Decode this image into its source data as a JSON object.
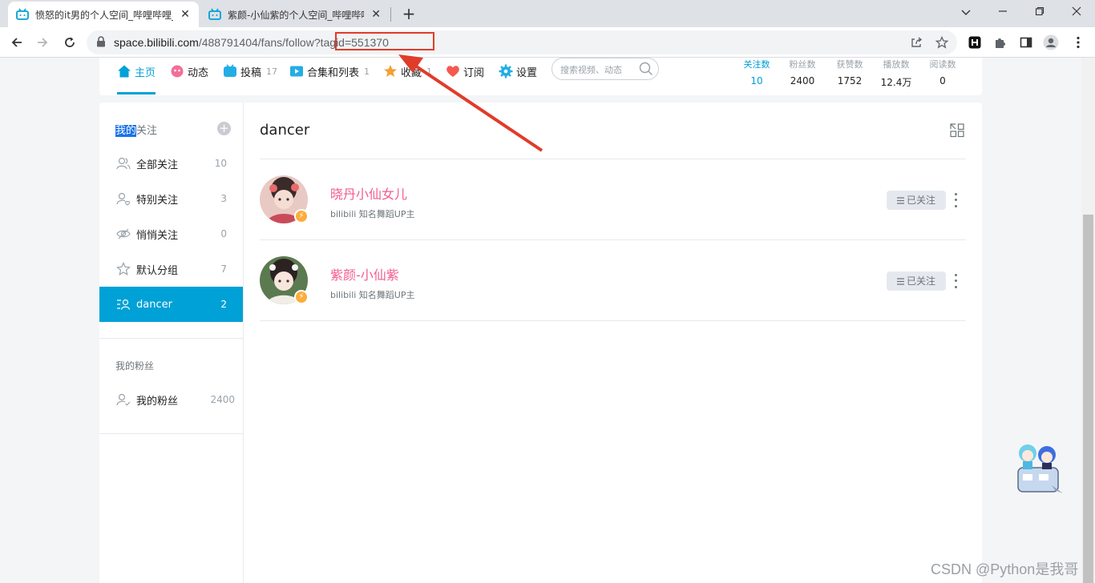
{
  "browser": {
    "tabs": [
      {
        "title": "愤怒的it男的个人空间_哔哩哔哩_",
        "active": true
      },
      {
        "title": "紫颜-小仙紫的个人空间_哔哩哔哩",
        "active": false
      }
    ],
    "url_host": "space.bilibili.com",
    "url_path": "/488791404/fans/follow?tagid=551370",
    "tab_close": "✕",
    "new_tab": "+"
  },
  "nav": {
    "items": [
      {
        "label": "主页",
        "count": "",
        "icon": "home-icon",
        "color": "#00a1d6"
      },
      {
        "label": "动态",
        "count": "",
        "icon": "dynamic-icon",
        "color": "#f36f98"
      },
      {
        "label": "投稿",
        "count": "17",
        "icon": "upload-icon",
        "color": "#23ade5"
      },
      {
        "label": "合集和列表",
        "count": "1",
        "icon": "collection-icon",
        "color": "#23ade5"
      },
      {
        "label": "收藏",
        "count": "1",
        "icon": "star-icon",
        "color": "#f3a034"
      },
      {
        "label": "订阅",
        "count": "",
        "icon": "heart-icon",
        "color": "#f45a4f"
      },
      {
        "label": "设置",
        "count": "",
        "icon": "gear-icon",
        "color": "#23ade5"
      }
    ],
    "search_placeholder": "搜索视频、动态",
    "stats": [
      {
        "label": "关注数",
        "value": "10"
      },
      {
        "label": "粉丝数",
        "value": "2400"
      },
      {
        "label": "获赞数",
        "value": "1752"
      },
      {
        "label": "播放数",
        "value": "12.4万"
      },
      {
        "label": "阅读数",
        "value": "0"
      }
    ]
  },
  "sidebar": {
    "head_selected": "我的",
    "head_rest": "关注",
    "add": "+",
    "items": [
      {
        "label": "全部关注",
        "count": "10"
      },
      {
        "label": "特别关注",
        "count": "3"
      },
      {
        "label": "悄悄关注",
        "count": "0"
      },
      {
        "label": "默认分组",
        "count": "7"
      },
      {
        "label": "dancer",
        "count": "2"
      }
    ],
    "fans_section": "我的粉丝",
    "fans_item": {
      "label": "我的粉丝",
      "count": "2400"
    }
  },
  "content": {
    "title": "dancer",
    "users": [
      {
        "name": "晓丹小仙女儿",
        "desc": "bilibili 知名舞蹈UP主",
        "button": "已关注"
      },
      {
        "name": "紫颜-小仙紫",
        "desc": "bilibili 知名舞蹈UP主",
        "button": "已关注"
      }
    ]
  },
  "watermark": "CSDN @Python是我哥",
  "colors": {
    "accent": "#00a1d6",
    "username": "#f25d8e",
    "annotation": "#e03c2a"
  }
}
